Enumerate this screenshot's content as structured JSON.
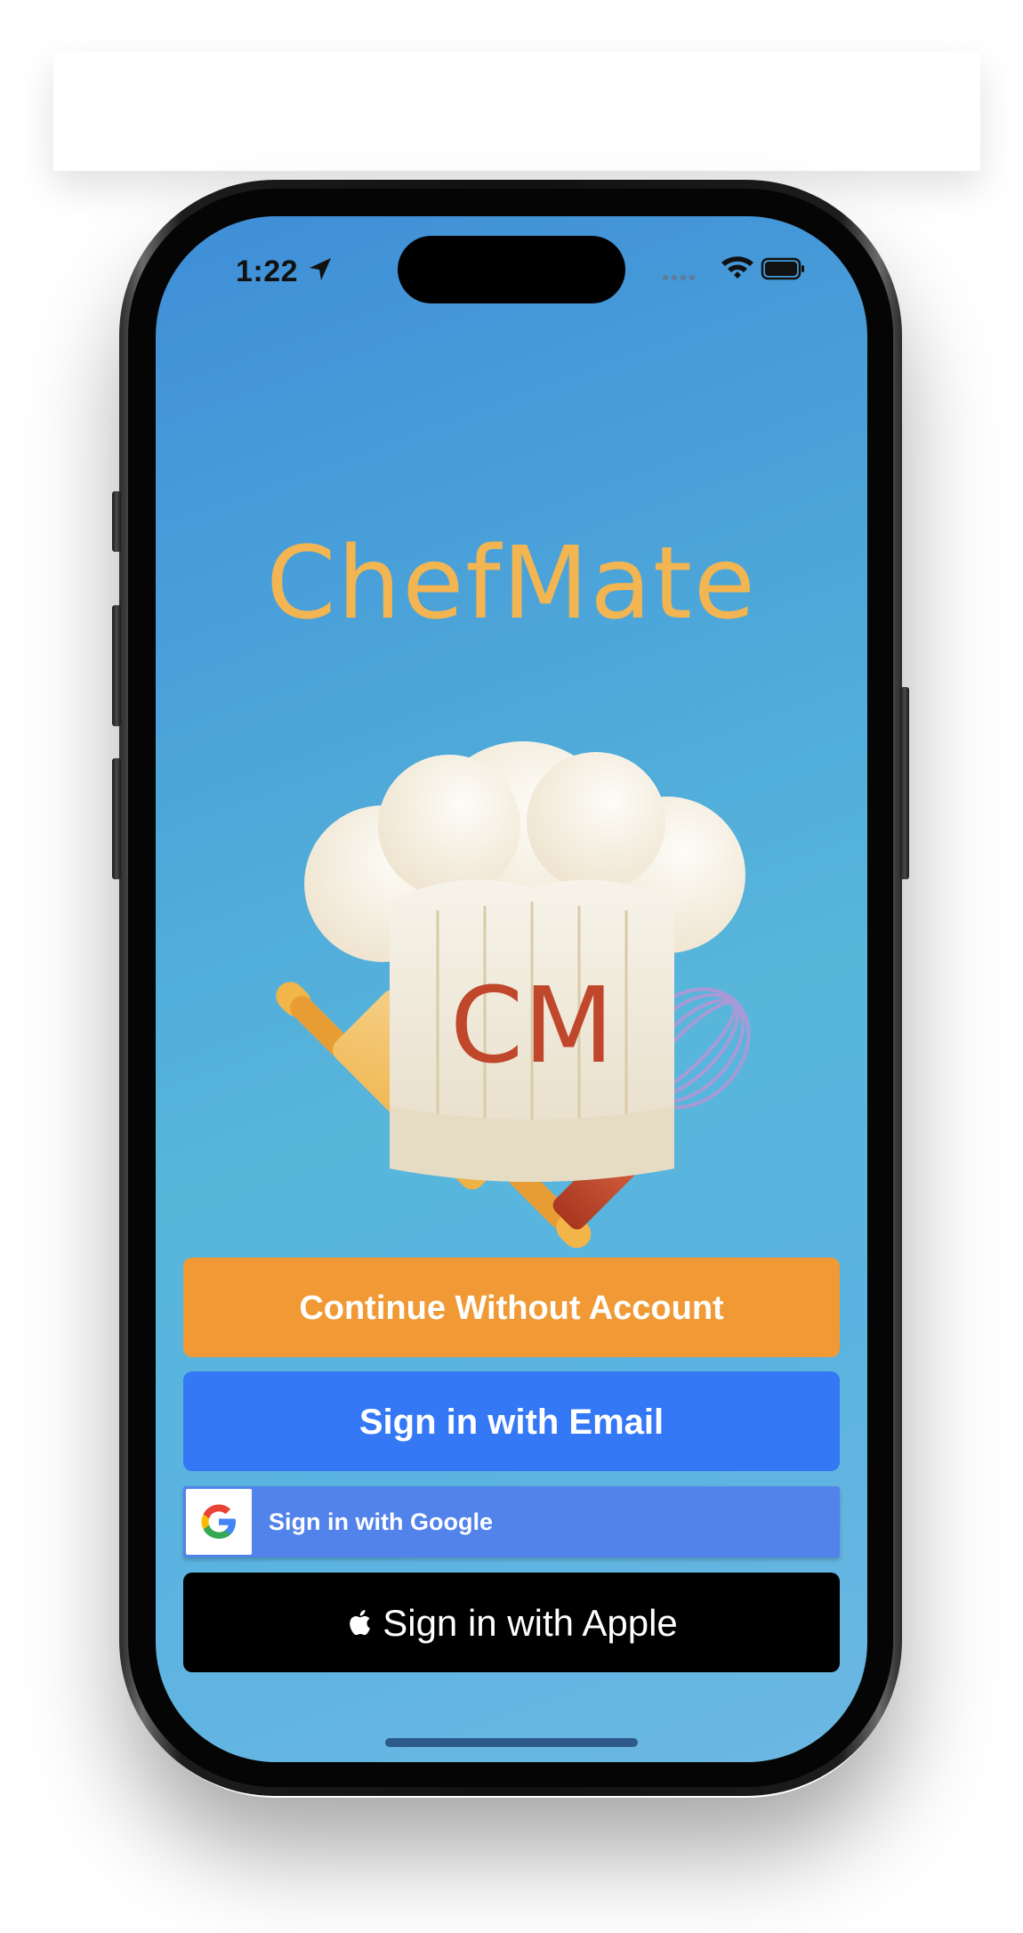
{
  "status_bar": {
    "time": "1:22",
    "icons": [
      "location-arrow-icon",
      "cellular-signal-icon",
      "wifi-icon",
      "battery-icon"
    ]
  },
  "app": {
    "title": "ChefMate",
    "logo_monogram": "CM",
    "title_color": "#f2b552"
  },
  "buttons": {
    "guest": {
      "label": "Continue Without Account",
      "color": "#f19a35"
    },
    "email": {
      "label": "Sign in with Email",
      "color": "#3478f6"
    },
    "google": {
      "label": "Sign in with Google",
      "color": "#5283ea",
      "icon": "google-g-icon"
    },
    "apple": {
      "label": "Sign in with Apple",
      "color": "#000000",
      "icon": "apple-logo-icon"
    }
  }
}
